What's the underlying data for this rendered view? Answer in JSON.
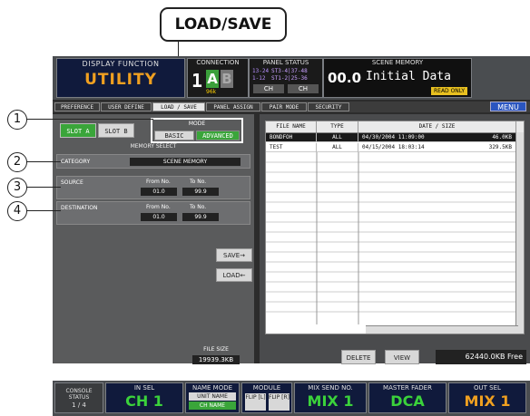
{
  "callout": {
    "title": "LOAD/SAVE"
  },
  "header": {
    "display_function_label": "DISPLAY FUNCTION",
    "display_function_value": "UTILITY",
    "connection_label": "CONNECTION",
    "connection_number": "1",
    "connection_a": "A",
    "connection_b": "B",
    "connection_sub": "96k",
    "panel_status_label": "PANEL STATUS",
    "panel_status_left": "13-24\n1-12",
    "panel_status_right": "ST3-4|37-48\nST1-2|25-36",
    "panel_ch_1": "CH",
    "panel_ch_2": "CH",
    "scene_memory_label": "SCENE MEMORY",
    "scene_number": "00.0",
    "scene_name": "Initial Data",
    "read_only": "READ ONLY"
  },
  "tabs": [
    {
      "label": "PREFERENCE"
    },
    {
      "label": "USER DEFINE"
    },
    {
      "label": "LOAD / SAVE"
    },
    {
      "label": "PANEL ASSIGN"
    },
    {
      "label": "PAIR MODE"
    },
    {
      "label": "SECURITY"
    }
  ],
  "menu_label": "MENU",
  "left": {
    "slot_a": "SLOT A",
    "slot_b": "SLOT B",
    "mode_label": "MODE",
    "mode_basic": "BASIC",
    "mode_advanced": "ADVANCED",
    "memory_select": "MEMORY SELECT",
    "category_label": "CATEGORY",
    "category_value": "SCENE MEMORY",
    "source_label": "SOURCE",
    "destination_label": "DESTINATION",
    "from_no": "From No.",
    "to_no": "To No.",
    "source_from": "01.0",
    "source_to": "99.9",
    "dest_from": "01.0",
    "dest_to": "99.9",
    "save_button": "SAVE→",
    "load_button": "LOAD←",
    "file_size_label": "FILE SIZE",
    "file_size_value": "19939.3KB"
  },
  "files": {
    "headers": [
      "FILE NAME",
      "TYPE",
      "DATE / SIZE"
    ],
    "rows": [
      {
        "name": "BONDFOH",
        "type": "ALL",
        "date": "04/30/2004 11:09:00",
        "size": "46.0KB"
      },
      {
        "name": "TEST",
        "type": "ALL",
        "date": "04/15/2004 18:03:14",
        "size": "329.5KB"
      }
    ],
    "delete_button": "DELETE",
    "view_button": "VIEW",
    "free_space": "62440.0KB Free"
  },
  "callouts": [
    "1",
    "2",
    "3",
    "4"
  ],
  "bottom": {
    "console_status": "CONSOLE STATUS",
    "console_page": "1 / 4",
    "in_sel_label": "IN SEL",
    "in_sel_value": "CH 1",
    "name_mode_label": "NAME MODE",
    "name_mode_unit": "UNIT NAME",
    "name_mode_ch": "CH NAME",
    "module_label": "MODULE",
    "flip_l": "FLIP [L]",
    "flip_r": "FLIP [R]",
    "mix_send_label": "MIX SEND NO.",
    "mix_send_value": "MIX 1",
    "master_fader_label": "MASTER FADER",
    "master_fader_value": "DCA",
    "out_sel_label": "OUT SEL",
    "out_sel_value": "MIX 1"
  },
  "colors": {
    "accent_green": "#3aa53a",
    "orange": "#f0a020",
    "menu_blue": "#2a55c0",
    "bottom_green": "#3bd23b"
  }
}
